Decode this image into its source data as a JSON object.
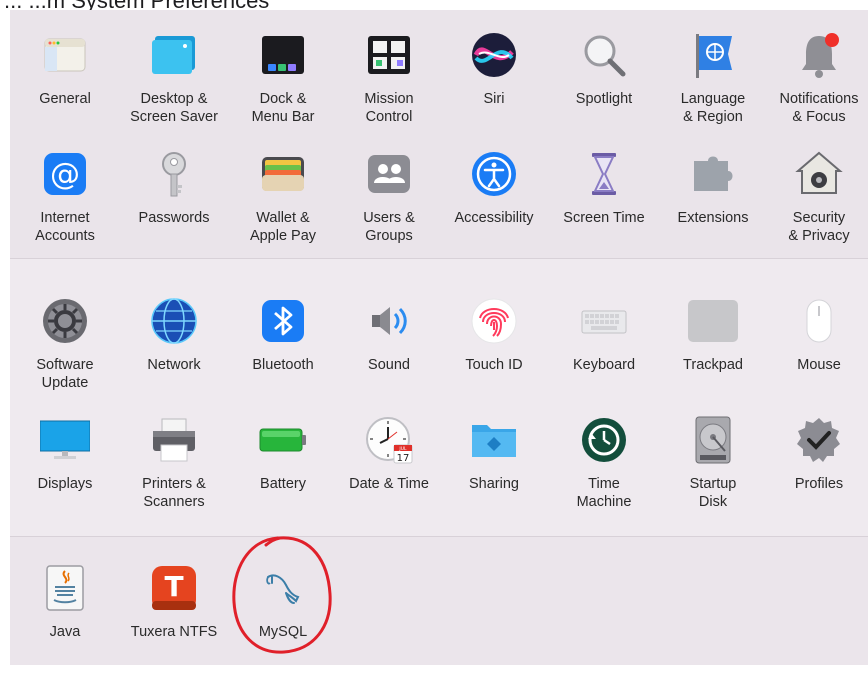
{
  "window": {
    "title": "... ...m System Preferences"
  },
  "sections": [
    {
      "items": [
        {
          "label": "General",
          "icon": "general-icon"
        },
        {
          "label": "Desktop &\nScreen Saver",
          "icon": "desktop-icon"
        },
        {
          "label": "Dock &\nMenu Bar",
          "icon": "dock-icon"
        },
        {
          "label": "Mission\nControl",
          "icon": "mission-control-icon"
        },
        {
          "label": "Siri",
          "icon": "siri-icon"
        },
        {
          "label": "Spotlight",
          "icon": "spotlight-icon"
        },
        {
          "label": "Language\n& Region",
          "icon": "language-icon"
        },
        {
          "label": "Notifications\n& Focus",
          "icon": "notifications-icon"
        },
        {
          "label": "Internet\nAccounts",
          "icon": "internet-accounts-icon"
        },
        {
          "label": "Passwords",
          "icon": "key-icon"
        },
        {
          "label": "Wallet &\nApple Pay",
          "icon": "wallet-icon"
        },
        {
          "label": "Users &\nGroups",
          "icon": "users-icon"
        },
        {
          "label": "Accessibility",
          "icon": "accessibility-icon"
        },
        {
          "label": "Screen Time",
          "icon": "hourglass-icon"
        },
        {
          "label": "Extensions",
          "icon": "puzzle-icon"
        },
        {
          "label": "Security\n& Privacy",
          "icon": "security-icon"
        }
      ]
    },
    {
      "items": [
        {
          "label": "Software\nUpdate",
          "icon": "software-update-icon"
        },
        {
          "label": "Network",
          "icon": "globe-icon"
        },
        {
          "label": "Bluetooth",
          "icon": "bluetooth-icon"
        },
        {
          "label": "Sound",
          "icon": "speaker-icon"
        },
        {
          "label": "Touch ID",
          "icon": "fingerprint-icon"
        },
        {
          "label": "Keyboard",
          "icon": "keyboard-icon"
        },
        {
          "label": "Trackpad",
          "icon": "trackpad-icon"
        },
        {
          "label": "Mouse",
          "icon": "mouse-icon"
        },
        {
          "label": "Displays",
          "icon": "display-icon"
        },
        {
          "label": "Printers &\nScanners",
          "icon": "printer-icon"
        },
        {
          "label": "Battery",
          "icon": "battery-icon"
        },
        {
          "label": "Date & Time",
          "icon": "clock-icon"
        },
        {
          "label": "Sharing",
          "icon": "folder-icon"
        },
        {
          "label": "Time\nMachine",
          "icon": "time-machine-icon"
        },
        {
          "label": "Startup\nDisk",
          "icon": "disk-icon"
        },
        {
          "label": "Profiles",
          "icon": "profiles-icon"
        }
      ]
    },
    {
      "items": [
        {
          "label": "Java",
          "icon": "java-icon"
        },
        {
          "label": "Tuxera NTFS",
          "icon": "tuxera-icon"
        },
        {
          "label": "MySQL",
          "icon": "mysql-dolphin-icon"
        }
      ]
    }
  ],
  "date_time_icon": {
    "month": "JUL",
    "day": "17"
  },
  "tuxera_icon": {
    "letter": "T"
  },
  "colors": {
    "annotation": "#e0202a",
    "accent_blue": "#1a7cf5",
    "notification_badge": "#f0302a"
  }
}
